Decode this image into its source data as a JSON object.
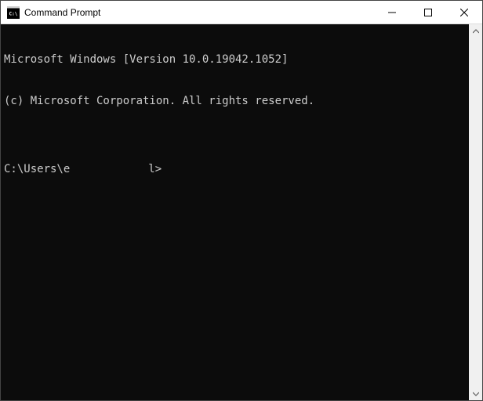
{
  "titlebar": {
    "title": "Command Prompt"
  },
  "terminal": {
    "line1": "Microsoft Windows [Version 10.0.19042.1052]",
    "line2": "(c) Microsoft Corporation. All rights reserved.",
    "line3": "",
    "prompt_prefix": "C:\\Users\\e",
    "prompt_suffix": "l>"
  }
}
